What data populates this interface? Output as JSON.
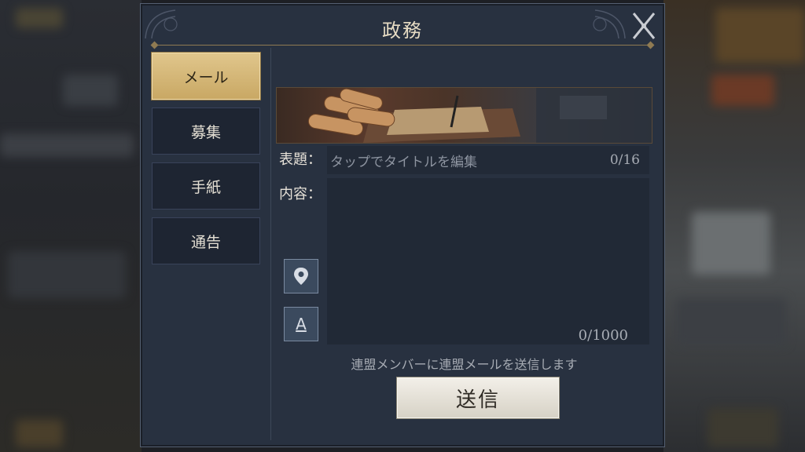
{
  "window": {
    "title": "政務"
  },
  "tabs": [
    {
      "label": "メール",
      "active": true
    },
    {
      "label": "募集",
      "active": false
    },
    {
      "label": "手紙",
      "active": false
    },
    {
      "label": "通告",
      "active": false
    }
  ],
  "form": {
    "subject_label": "表題：",
    "subject_placeholder": "タップでタイトルを編集",
    "subject_count": "0/16",
    "content_label": "内容：",
    "content_count": "0/1000"
  },
  "tools": {
    "font_button": "A"
  },
  "hint": "連盟メンバーに連盟メールを送信します",
  "send_button": "送信",
  "icons": [
    "close-icon",
    "location-pin-icon",
    "font-format-icon"
  ],
  "colors": {
    "accent_gold": "#d9bd7c",
    "panel": "#283140"
  }
}
